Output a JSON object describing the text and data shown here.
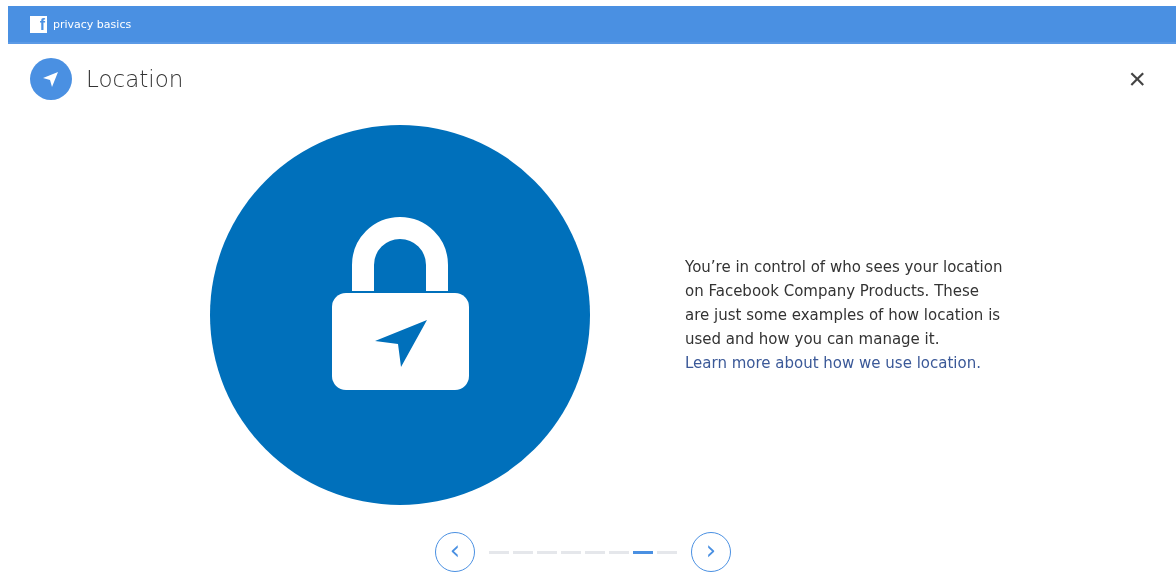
{
  "topbar": {
    "logo": "f",
    "title": "privacy basics"
  },
  "header": {
    "title": "Location",
    "close": "×"
  },
  "content": {
    "text": "You’re in control of who sees your location on Facebook Company Products. These are just some examples of how location is used and how you can manage it.",
    "link": "Learn more about how we use location."
  },
  "pager": {
    "prev": "‹",
    "next": "›",
    "pages": [
      {
        "selected": false
      },
      {
        "selected": false
      },
      {
        "selected": false
      },
      {
        "selected": false
      },
      {
        "selected": false
      },
      {
        "selected": false
      },
      {
        "selected": true
      },
      {
        "selected": false
      }
    ]
  }
}
